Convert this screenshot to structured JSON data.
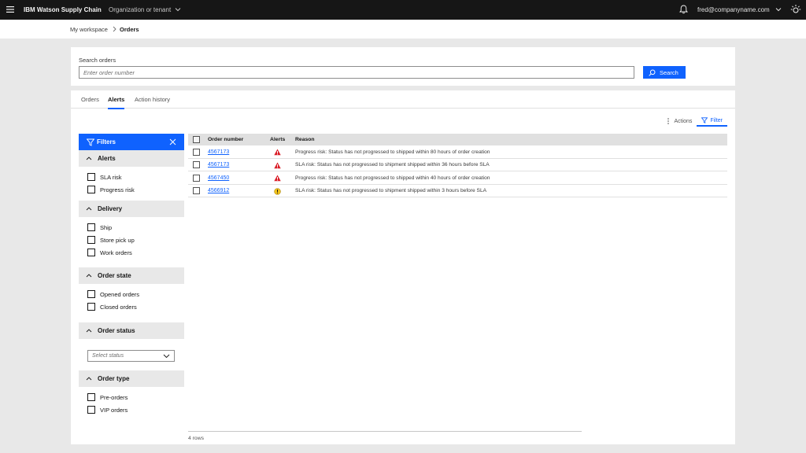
{
  "topbar": {
    "product_name": "IBM Watson Supply Chain",
    "tenant_selector": "Organization or tenant",
    "user_email": "fred@companyname.com"
  },
  "breadcrumb": {
    "items": [
      "My workspace",
      "Orders"
    ]
  },
  "search": {
    "label": "Search orders",
    "placeholder": "Enter order number",
    "value": "",
    "button_label": "Search"
  },
  "tabs": [
    {
      "label": "Orders",
      "active": false
    },
    {
      "label": "Alerts",
      "active": true
    },
    {
      "label": "Action history",
      "active": false
    }
  ],
  "toolbar": {
    "actions_label": "Actions",
    "filter_label": "Filter"
  },
  "filters": {
    "title": "Filters",
    "groups": [
      {
        "title": "Alerts",
        "options": [
          "SLA risk",
          "Progress risk"
        ]
      },
      {
        "title": "Delivery",
        "options": [
          "Ship",
          "Store pick up",
          "Work orders"
        ]
      },
      {
        "title": "Order state",
        "options": [
          "Opened orders",
          "Closed orders"
        ]
      },
      {
        "title": "Order status",
        "select_placeholder": "Select status"
      },
      {
        "title": "Order type",
        "options": [
          "Pre-orders",
          "VIP orders"
        ]
      }
    ]
  },
  "table": {
    "columns": [
      "Order number",
      "Alerts",
      "Reason"
    ],
    "rows": [
      {
        "order_number": "4567173",
        "alert": "critical",
        "reason": "Progress risk: Status has not progressed to shipped within 80 hours of order creation"
      },
      {
        "order_number": "4567173",
        "alert": "critical",
        "reason": "SLA risk: Status has not progressed to shipment shipped within 36 hours before SLA"
      },
      {
        "order_number": "4567450",
        "alert": "critical",
        "reason": "Progress risk: Status has not progressed to shipped within 40 hours of order creation"
      },
      {
        "order_number": "4566912",
        "alert": "warning",
        "reason": "SLA risk: Status has not progressed to shipment shipped within 3 hours before SLA"
      }
    ],
    "row_count_label": "4 rows"
  },
  "colors": {
    "accent": "#0f62fe",
    "critical": "#da1e28",
    "warning": "#f1c21b",
    "topbar": "#161616"
  }
}
